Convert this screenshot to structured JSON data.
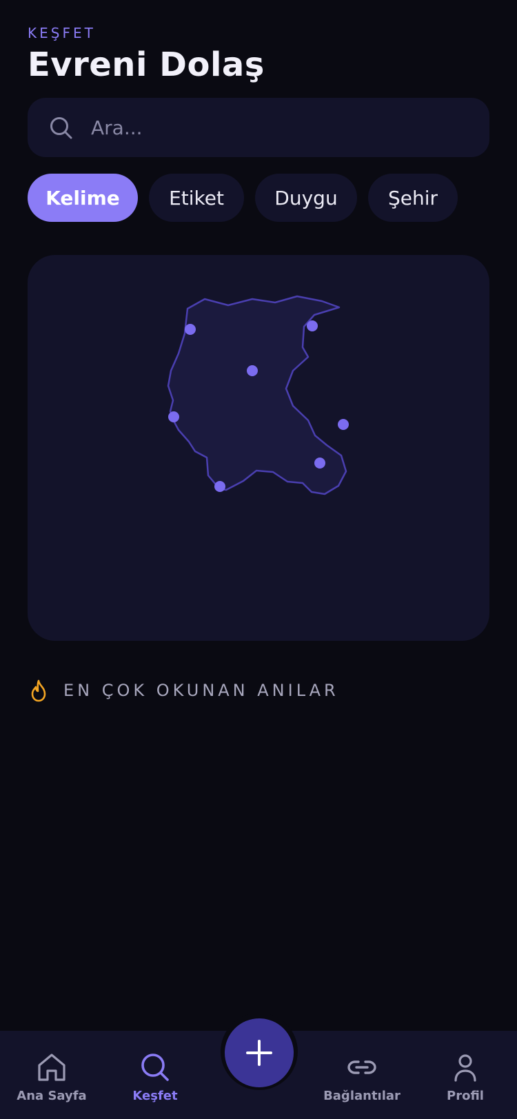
{
  "header": {
    "eyebrow": "KEŞFET",
    "title": "Evreni Dolaş"
  },
  "search": {
    "placeholder": "Ara...",
    "value": ""
  },
  "filters": [
    {
      "label": "Kelime",
      "active": true
    },
    {
      "label": "Etiket",
      "active": false
    },
    {
      "label": "Duygu",
      "active": false
    },
    {
      "label": "Şehir",
      "active": false
    }
  ],
  "map": {
    "pin_count": 7
  },
  "section": {
    "icon": "flame-icon",
    "title": "EN ÇOK OKUNAN ANILAR"
  },
  "nav": {
    "items": [
      {
        "label": "Ana Sayfa",
        "icon": "home-icon",
        "active": false
      },
      {
        "label": "Keşfet",
        "icon": "search-icon",
        "active": true
      },
      {
        "label": "Bağlantılar",
        "icon": "link-icon",
        "active": false
      },
      {
        "label": "Profil",
        "icon": "user-icon",
        "active": false
      }
    ],
    "fab_icon": "plus-icon"
  },
  "colors": {
    "background": "#0a0a12",
    "surface": "#13132a",
    "accent": "#8b7cf6",
    "fab": "#3b3496",
    "flame": "#f5a623"
  }
}
